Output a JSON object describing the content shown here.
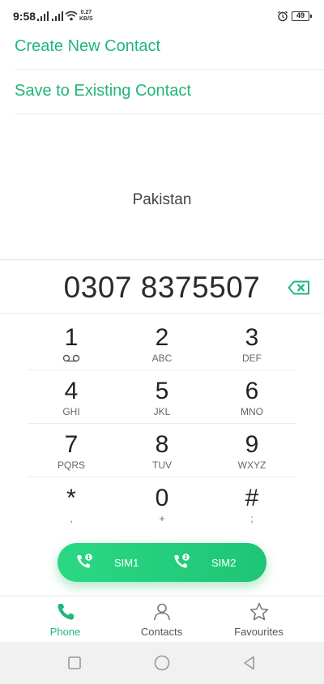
{
  "status_bar": {
    "time": "9:58",
    "speed_value": "0.27",
    "speed_unit": "KB/S",
    "battery": "49"
  },
  "actions": {
    "create_new": "Create New Contact",
    "save_existing": "Save to Existing Contact"
  },
  "location": "Pakistan",
  "dial_number": "0307 8375507",
  "keypad": [
    {
      "digit": "1",
      "letters": ""
    },
    {
      "digit": "2",
      "letters": "ABC"
    },
    {
      "digit": "3",
      "letters": "DEF"
    },
    {
      "digit": "4",
      "letters": "GHI"
    },
    {
      "digit": "5",
      "letters": "JKL"
    },
    {
      "digit": "6",
      "letters": "MNO"
    },
    {
      "digit": "7",
      "letters": "PQRS"
    },
    {
      "digit": "8",
      "letters": "TUV"
    },
    {
      "digit": "9",
      "letters": "WXYZ"
    },
    {
      "digit": "*",
      "letters": ","
    },
    {
      "digit": "0",
      "letters": "+"
    },
    {
      "digit": "#",
      "letters": ";"
    }
  ],
  "sim_buttons": {
    "sim1": "SIM1",
    "sim1_badge": "1",
    "sim2": "SIM2",
    "sim2_badge": "2"
  },
  "bottom_nav": {
    "phone": "Phone",
    "contacts": "Contacts",
    "favourites": "Favourites"
  },
  "colors": {
    "accent": "#22b67a",
    "call_gradient_start": "#2ad883",
    "call_gradient_end": "#1ec575"
  },
  "icons": [
    "signal-icon",
    "wifi-icon",
    "alarm-icon",
    "battery-icon",
    "backspace-icon",
    "voicemail-icon",
    "call-icon",
    "contacts-icon",
    "star-icon",
    "recent-apps-icon",
    "home-icon",
    "back-icon"
  ]
}
